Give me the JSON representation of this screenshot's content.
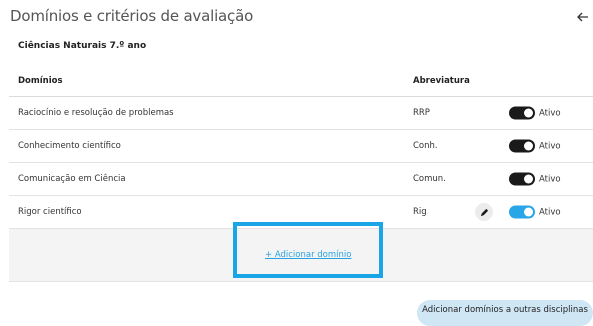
{
  "page": {
    "title": "Domínios e critérios de avaliação",
    "back_icon": "arrow-left-icon"
  },
  "subject": "Ciências Naturais 7.º ano",
  "table": {
    "headers": {
      "domain": "Domínios",
      "abbr": "Abreviatura"
    },
    "rows": [
      {
        "domain": "Raciocínio e resolução de problemas",
        "abbr": "RRP",
        "status": "Ativo",
        "toggle_color": "#1a1a1a",
        "editable": false
      },
      {
        "domain": "Conhecimento científico",
        "abbr": "Conh.",
        "status": "Ativo",
        "toggle_color": "#1a1a1a",
        "editable": false
      },
      {
        "domain": "Comunicação em Ciência",
        "abbr": "Comun.",
        "status": "Ativo",
        "toggle_color": "#1a1a1a",
        "editable": false
      },
      {
        "domain": "Rigor científico",
        "abbr": "Rig",
        "status": "Ativo",
        "toggle_color": "#29a6e8",
        "editable": true
      }
    ],
    "add_label": "+ Adicionar domínio"
  },
  "actions": {
    "add_to_other": "Adicionar domínios a outras disciplinas"
  },
  "colors": {
    "accent": "#29a6e8",
    "highlight": "#1aa6e6",
    "button_bg": "#cfe6f4"
  }
}
